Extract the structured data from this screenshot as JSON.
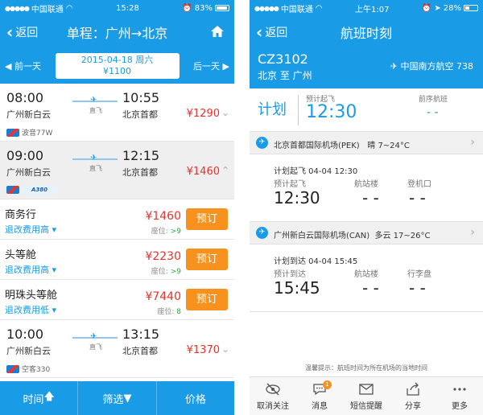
{
  "left": {
    "status": {
      "carrier": "中国联通",
      "time": "15:28",
      "battery": "83%"
    },
    "nav": {
      "back_label": "返回",
      "title": "单程：广州→北京"
    },
    "date_bar": {
      "prev_label": "前一天",
      "next_label": "后一天",
      "date": "2015-04-18 周六",
      "min_price": "¥1100"
    },
    "flights": [
      {
        "dep_time": "08:00",
        "arr_time": "10:55",
        "dep_port": "广州新白云",
        "arr_port": "北京首都",
        "direct": "直飞",
        "price": "¥1290",
        "aircraft": "波音77W"
      },
      {
        "dep_time": "09:00",
        "arr_time": "12:15",
        "dep_port": "广州新白云",
        "arr_port": "北京首都",
        "direct": "直飞",
        "price": "¥1460",
        "aircraft": "A380"
      },
      {
        "dep_time": "10:00",
        "arr_time": "13:15",
        "dep_port": "广州新白云",
        "arr_port": "北京首都",
        "direct": "直飞",
        "price": "¥1370",
        "aircraft": "空客330"
      }
    ],
    "cabins": [
      {
        "name": "商务行",
        "rule": "退改费用高",
        "price": "¥1460",
        "seat_label": "座位:",
        "seat_count": ">9",
        "book": "预订"
      },
      {
        "name": "头等舱",
        "rule": "退改费用高",
        "price": "¥2230",
        "seat_label": "座位:",
        "seat_count": ">9",
        "book": "预订"
      },
      {
        "name": "明珠头等舱",
        "rule": "退改费用低",
        "price": "¥7440",
        "seat_label": "座位:",
        "seat_count": "8",
        "book": "预订"
      }
    ],
    "tabs": {
      "time": "时间",
      "filter": "筛选",
      "price": "价格"
    }
  },
  "right": {
    "status": {
      "carrier": "中国联通",
      "time": "上午1:07",
      "battery": "28%"
    },
    "nav": {
      "back_label": "返回",
      "title": "航班时刻"
    },
    "flight": {
      "number": "CZ3102",
      "route": "北京 至 广州",
      "airline": "中国南方航空 738"
    },
    "plan": {
      "label": "计划",
      "est_label": "预计起飞",
      "est_time": "12:30",
      "prev_label": "前序航班",
      "prev_value": "- -"
    },
    "departure": {
      "airport": "北京首都国际机场(PEK)",
      "weather": "晴 7~24°C",
      "planned": "计划起飞 04-04 12:30",
      "est_label": "预计起飞",
      "est_value": "12:30",
      "terminal_label": "航站楼",
      "terminal_value": "- -",
      "gate_label": "登机口",
      "gate_value": "- -"
    },
    "arrival": {
      "airport": "广州新白云国际机场(CAN)",
      "weather": "多云 17~26°C",
      "planned": "计划到达 04-04 15:45",
      "est_label": "预计到达",
      "est_value": "15:45",
      "terminal_label": "航站楼",
      "terminal_value": "- -",
      "baggage_label": "行李盘",
      "baggage_value": "- -"
    },
    "hint": "温馨提示：航班时间为所在机场的当地时间",
    "tabs": {
      "unfollow": "取消关注",
      "message": "消息",
      "message_badge": "1",
      "sms": "短信提醒",
      "share": "分享",
      "more": "更多"
    }
  }
}
